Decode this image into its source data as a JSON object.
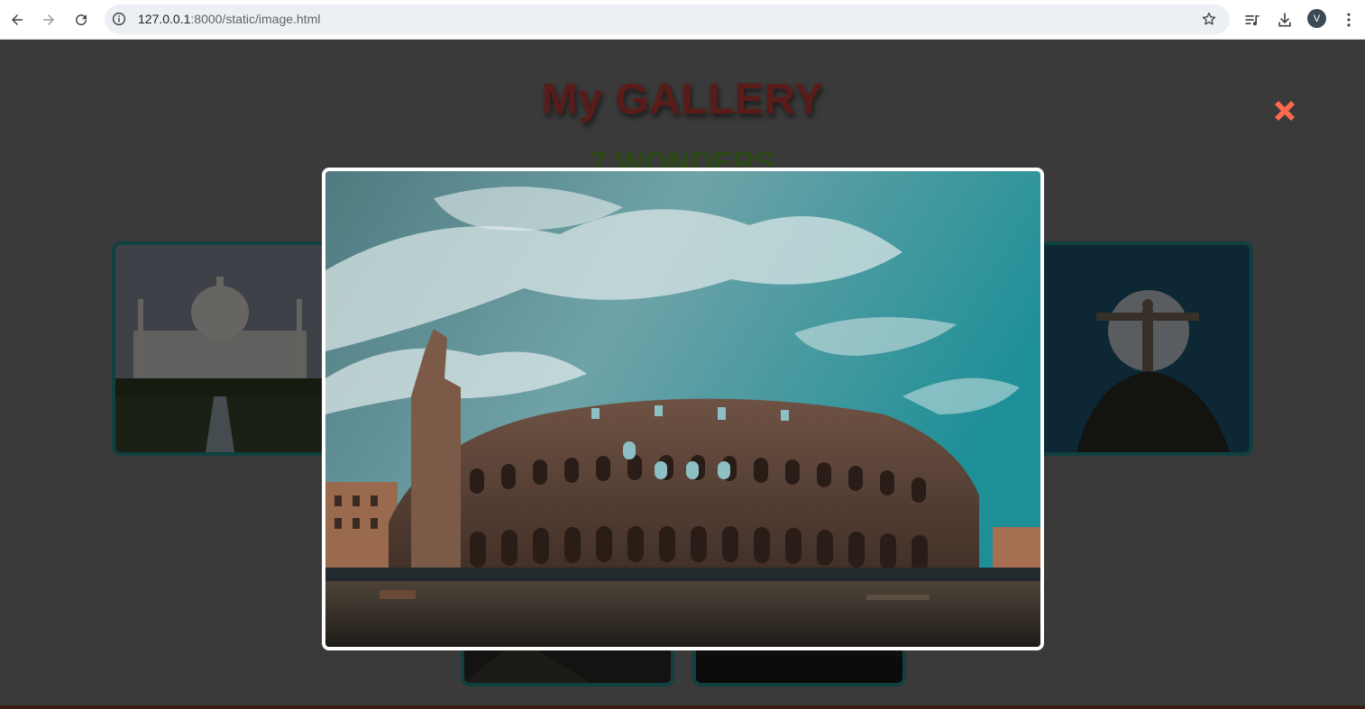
{
  "browser": {
    "url_host": "127.0.0.1",
    "url_rest": ":8000/static/image.html",
    "profile_initial": "V"
  },
  "gallery": {
    "title": "My GALLERY",
    "subtitle": "7 WONDERS"
  },
  "modal": {
    "image_subject": "Colosseum"
  },
  "colors": {
    "close_button": "#ff6a4d",
    "title": "#5a1c19",
    "subtitle": "#2c4a16",
    "card_border": "#10403f"
  },
  "icons": [
    "back-arrow-icon",
    "forward-arrow-icon",
    "reload-icon",
    "info-icon",
    "star-icon",
    "reading-list-icon",
    "download-icon",
    "menu-dots-icon",
    "close-icon"
  ]
}
